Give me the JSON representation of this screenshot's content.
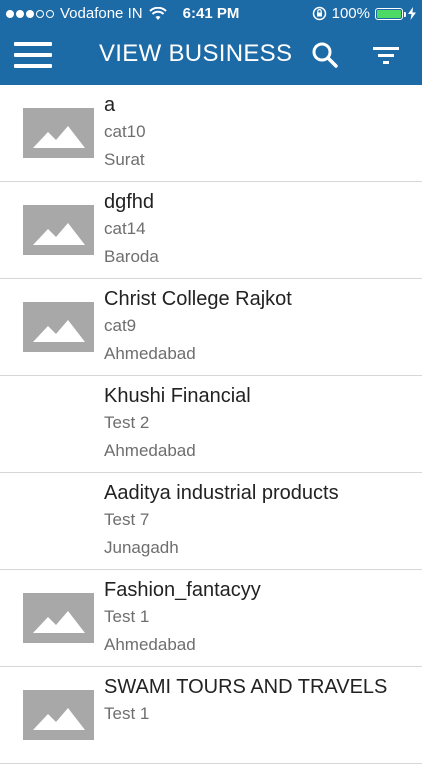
{
  "status_bar": {
    "carrier": "Vodafone IN",
    "time": "6:41 PM",
    "battery": "100%",
    "signal_bars_filled": 3,
    "signal_bars_total": 5
  },
  "header": {
    "title": "VIEW BUSINESS",
    "menu_icon": "hamburger-icon",
    "search_icon": "search-icon",
    "filter_icon": "filter-icon",
    "background": "#1c6aa6"
  },
  "businesses": [
    {
      "name": "a",
      "category": "cat10",
      "city": "Surat",
      "has_image": true
    },
    {
      "name": "dgfhd",
      "category": "cat14",
      "city": "Baroda",
      "has_image": true
    },
    {
      "name": "Christ College Rajkot",
      "category": "cat9",
      "city": "Ahmedabad",
      "has_image": true
    },
    {
      "name": "Khushi Financial",
      "category": "Test 2",
      "city": "Ahmedabad",
      "has_image": false
    },
    {
      "name": "Aaditya industrial products",
      "category": "Test 7",
      "city": "Junagadh",
      "has_image": false
    },
    {
      "name": "Fashion_fantacyy",
      "category": "Test 1",
      "city": "Ahmedabad",
      "has_image": true
    },
    {
      "name": "SWAMI TOURS AND TRAVELS",
      "category": "Test 1",
      "city": "",
      "has_image": true
    }
  ]
}
